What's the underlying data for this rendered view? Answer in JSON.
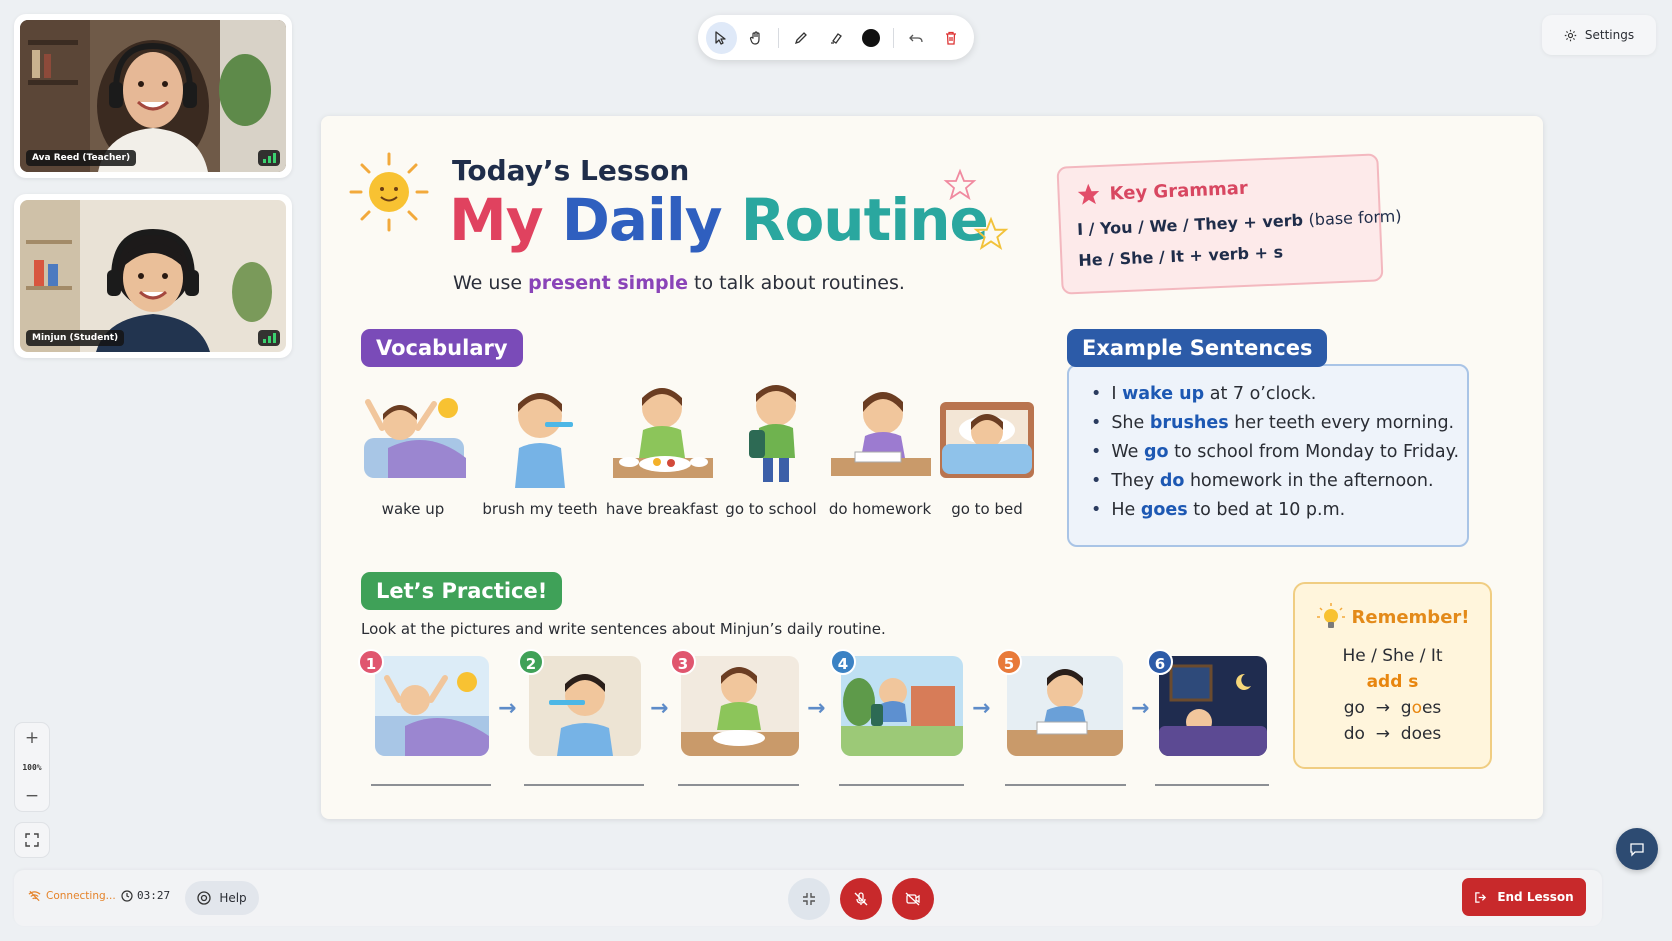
{
  "participants": [
    {
      "name": "Ava Reed (Teacher)"
    },
    {
      "name": "Minjun (Student)"
    }
  ],
  "toolbar": {
    "tools": [
      "select-icon",
      "hand-icon",
      "pencil-icon",
      "highlighter-icon",
      "color-swatch",
      "undo-icon",
      "trash-icon"
    ],
    "pen_color": "#111111"
  },
  "settings": {
    "label": "Settings"
  },
  "slide": {
    "kicker": "Today’s Lesson",
    "title_words": [
      {
        "text": "My",
        "color": "#e0425f"
      },
      {
        "text": "Daily",
        "color": "#2f5fbf"
      },
      {
        "text": "Routine",
        "color": "#2aa79f"
      }
    ],
    "subtitle_pre": "We use",
    "subtitle_highlight": "present simple",
    "subtitle_post": "to talk about routines.",
    "grammar": {
      "title": "Key Grammar",
      "line1": "I / You / We / They + verb",
      "line1_note": "(base form)",
      "line2": "He / She / It + verb + s"
    },
    "vocabulary": {
      "label": "Vocabulary",
      "items": [
        "wake up",
        "brush my teeth",
        "have breakfast",
        "go to school",
        "do homework",
        "go to bed"
      ]
    },
    "examples": {
      "label": "Example Sentences",
      "sentences": [
        {
          "pre": "I",
          "verb": "wake up",
          "post": "at 7 o’clock."
        },
        {
          "pre": "She",
          "verb": "brushes",
          "post": "her teeth every morning."
        },
        {
          "pre": "We",
          "verb": "go",
          "post": "to school from Monday to Friday."
        },
        {
          "pre": "They",
          "verb": "do",
          "post": "homework in the afternoon."
        },
        {
          "pre": "He",
          "verb": "goes",
          "post": "to bed at 10 p.m."
        }
      ]
    },
    "practice": {
      "label": "Let’s Practice!",
      "instruction": "Look at the pictures and write sentences about Minjun’s daily routine.",
      "steps": [
        "1",
        "2",
        "3",
        "4",
        "5",
        "6"
      ]
    },
    "remember": {
      "title": "Remember!",
      "line1": "He / She / It",
      "line2": "add s",
      "line3_pre": "go",
      "line3_arrow": "→",
      "line3_post_a": "g",
      "line3_post_b": "o",
      "line3_post_c": "es",
      "line4_pre": "do",
      "line4_arrow": "→",
      "line4_post": "does"
    }
  },
  "zoom": {
    "plus": "+",
    "value": "100%",
    "minus": "−"
  },
  "bottom": {
    "status": "Connecting...",
    "timer": "03:27",
    "help": "Help",
    "end": "End Lesson"
  },
  "colors": {
    "vocab_pill": "#7a4bb8",
    "examples_pill": "#2c5ba8",
    "practice_pill": "#3fa158",
    "danger": "#c8292b",
    "badge_colors": [
      "#e0566f",
      "#3fa158",
      "#e0566f",
      "#3b82c4",
      "#e87a3a",
      "#2c5ba8"
    ]
  }
}
